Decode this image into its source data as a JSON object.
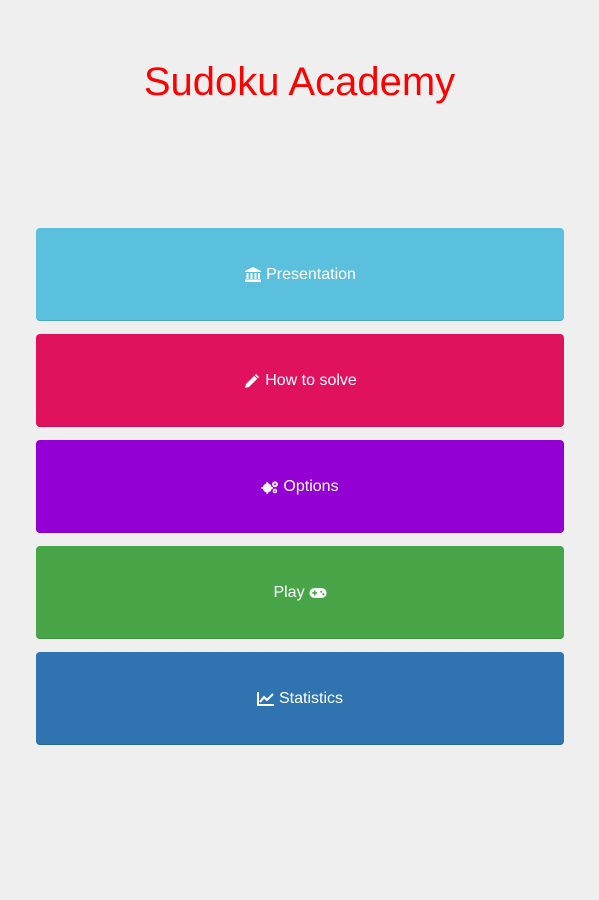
{
  "app": {
    "title": "Sudoku Academy",
    "title_color": "#ff0000",
    "background": "#efefef"
  },
  "menu": {
    "items": [
      {
        "label": "Presentation",
        "icon": "bank-icon",
        "color": "#5bc0de"
      },
      {
        "label": "How to solve",
        "icon": "pencil-icon",
        "color": "#e0115d"
      },
      {
        "label": "Options",
        "icon": "cogs-icon",
        "color": "#9400d3"
      },
      {
        "label": "Play",
        "icon": "gamepad-icon",
        "color": "#47a447"
      },
      {
        "label": "Statistics",
        "icon": "line-chart-icon",
        "color": "#2f73b0"
      }
    ]
  }
}
